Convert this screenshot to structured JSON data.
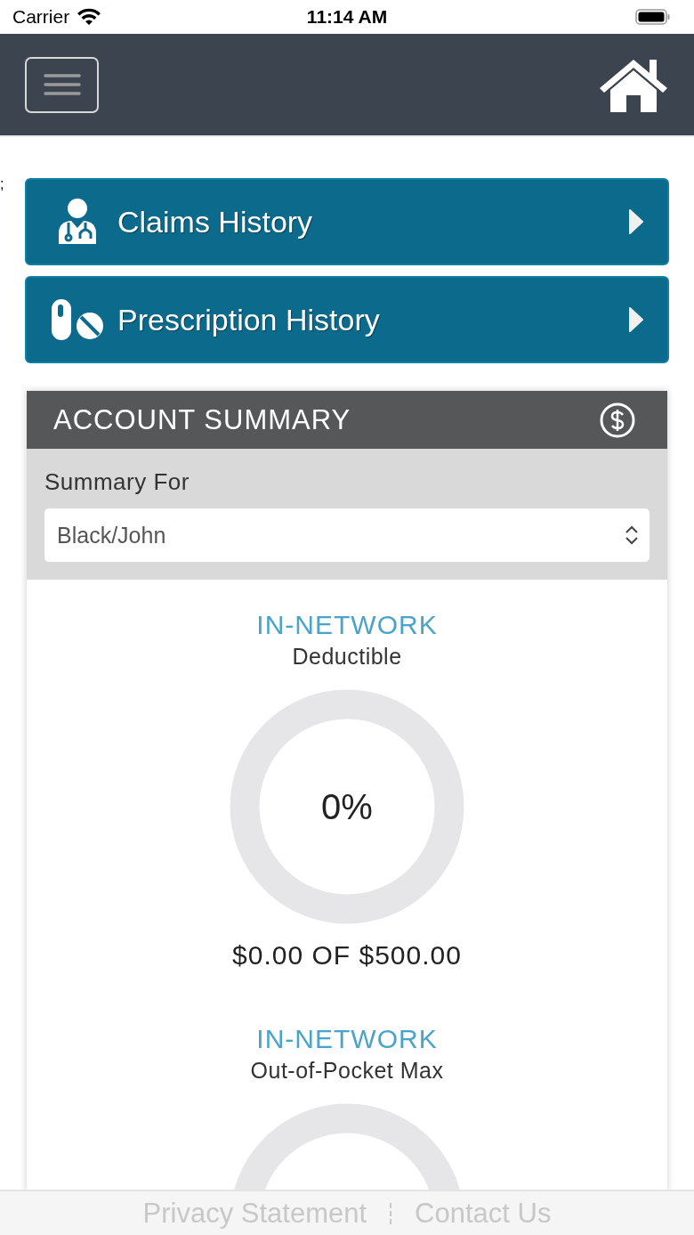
{
  "status_bar": {
    "carrier": "Carrier",
    "time": "11:14 AM"
  },
  "stray_text": ";",
  "nav_buttons": [
    {
      "kind": "doctor",
      "label": "Claims History"
    },
    {
      "kind": "pills",
      "label": "Prescription History"
    }
  ],
  "account_summary": {
    "title": "ACCOUNT SUMMARY",
    "summary_for_label": "Summary For",
    "member_select": {
      "value": "Black/John"
    },
    "meters": [
      {
        "network": "IN-NETWORK",
        "name": "Deductible",
        "percent": "0%",
        "amount": "$0.00 OF $500.00"
      },
      {
        "network": "IN-NETWORK",
        "name": "Out-of-Pocket Max"
      }
    ]
  },
  "footer_links": [
    "Privacy Statement",
    "Contact Us"
  ]
}
